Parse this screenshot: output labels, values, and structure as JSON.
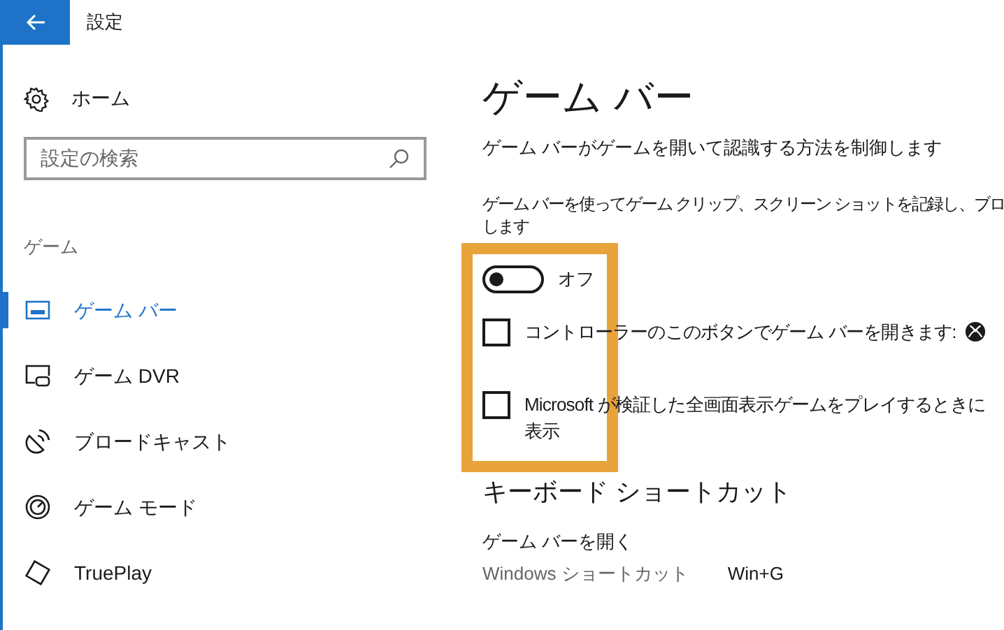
{
  "window": {
    "title": "設定"
  },
  "sidebar": {
    "home": "ホーム",
    "search": {
      "placeholder": "設定の検索"
    },
    "section": "ゲーム",
    "items": [
      {
        "label": "ゲーム バー",
        "selected": true,
        "kind": "gamebar"
      },
      {
        "label": "ゲーム DVR",
        "selected": false,
        "kind": "dvr"
      },
      {
        "label": "ブロードキャスト",
        "selected": false,
        "kind": "broadcast"
      },
      {
        "label": "ゲーム モード",
        "selected": false,
        "kind": "gamemode"
      },
      {
        "label": "TruePlay",
        "selected": false,
        "kind": "trueplay"
      }
    ]
  },
  "content": {
    "title": "ゲーム バー",
    "subtitle": "ゲーム バーがゲームを開いて認識する方法を制御します",
    "description": [
      "ゲーム バーを使ってゲーム クリップ、スクリーン ショットを記録し、ブロ",
      "します"
    ],
    "toggle": {
      "on": false,
      "label": "オフ"
    },
    "checkboxes": [
      {
        "label": "コントローラーのこのボタンでゲーム バーを開きます:",
        "checked": false,
        "kind": "xbox"
      },
      {
        "label": [
          "Microsoft が検証した全画面表示ゲームをプレイするときに",
          "表示"
        ],
        "checked": false,
        "kind": "plain"
      }
    ],
    "shortcuts": {
      "heading": "キーボード ショートカット",
      "items": [
        {
          "name": "ゲーム バーを開く",
          "label": "Windows ショートカット",
          "value": "Win+G"
        }
      ]
    }
  }
}
